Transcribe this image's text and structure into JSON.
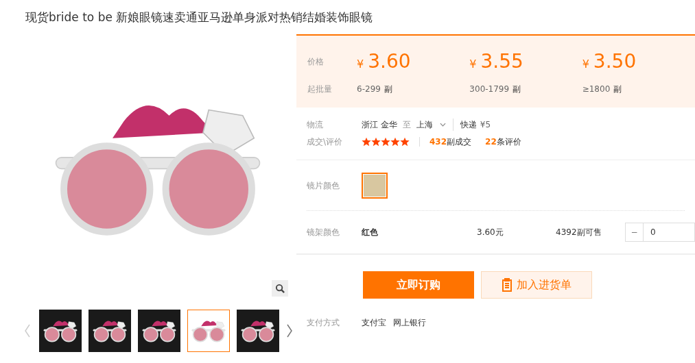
{
  "title": "现货bride to be 新娘眼镜速卖通亚马逊单身派对热销结婚装饰眼镜",
  "gallery": {
    "thumbnails": [
      {
        "selected": false
      },
      {
        "selected": false
      },
      {
        "selected": false
      },
      {
        "selected": true
      },
      {
        "selected": false
      }
    ]
  },
  "price": {
    "price_label": "价格",
    "qty_label": "起批量",
    "tiers": [
      {
        "currency": "¥",
        "price": "3.60",
        "range": "6-299",
        "unit": "副"
      },
      {
        "currency": "¥",
        "price": "3.55",
        "range": "300-1799",
        "unit": "副"
      },
      {
        "currency": "¥",
        "price": "3.50",
        "range": "≥1800",
        "unit": "副"
      }
    ]
  },
  "logistics": {
    "label": "物流",
    "from": "浙江 金华",
    "to_word": "至",
    "to": "上海",
    "method": "快递",
    "fee": "¥5"
  },
  "deals": {
    "label": "成交\\评价",
    "stars": 5,
    "sold_count": "432",
    "sold_text": "副成交",
    "review_count": "22",
    "review_text": "条评价"
  },
  "lens_color": {
    "label": "镜片颜色",
    "options": [
      {
        "selected": true
      }
    ]
  },
  "frame_color": {
    "label": "镜架颜色",
    "name": "红色",
    "price": "3.60元",
    "stock": "4392副可售",
    "minus": "−",
    "quantity": "0"
  },
  "actions": {
    "buy": "立即订购",
    "cart": "加入进货单"
  },
  "payment": {
    "label": "支付方式",
    "methods": [
      "支付宝",
      "网上银行"
    ]
  }
}
